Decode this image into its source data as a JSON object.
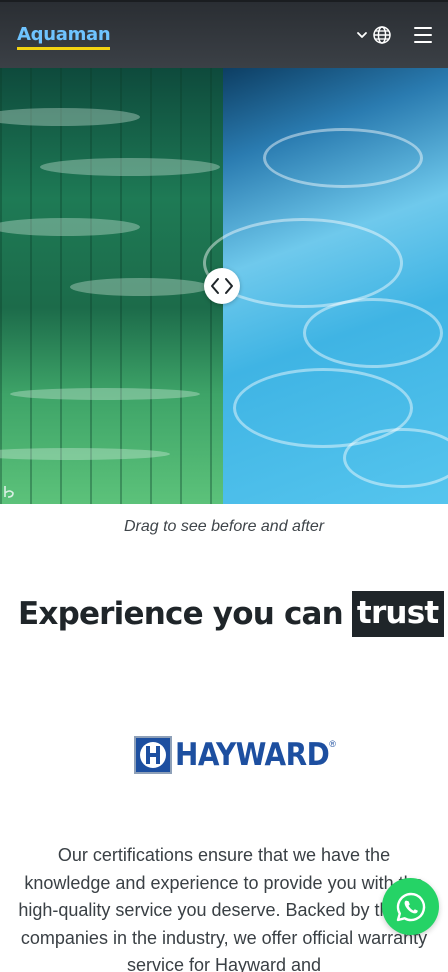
{
  "header": {
    "logo_text": "Aquaman",
    "menu_icon": "hamburger-icon",
    "language_icon": "globe-icon"
  },
  "compare": {
    "handle_icon": "drag-arrows-icon",
    "caption": "Drag to see before and after"
  },
  "section": {
    "heading_prefix": "Experience you can",
    "heading_highlight": "trust",
    "brand_name": "HAYWARD",
    "brand_reg": "®",
    "paragraph": "Our certifications ensure that we have the knowledge and experience to provide you with the high-quality service you deserve. Backed by the top companies in the industry, we offer official warranty service for Hayward and"
  },
  "fab": {
    "icon": "whatsapp-icon"
  },
  "colors": {
    "header_bg": "#2f3338",
    "logo": "#6fc4ff",
    "logo_underline": "#f2d311",
    "brand": "#1d4fa0",
    "whatsapp": "#25d366",
    "highlight_bg": "#1f2529"
  }
}
